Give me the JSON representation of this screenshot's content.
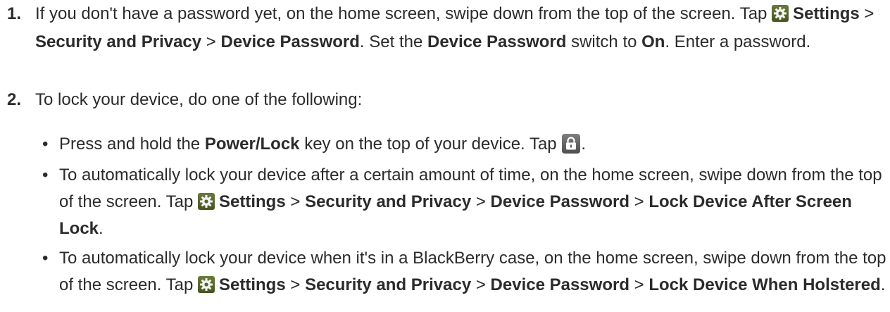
{
  "steps": [
    {
      "number": "1.",
      "segments": [
        {
          "t": "If you don't have a password yet, on the home screen, swipe down from the top of the screen. Tap "
        },
        {
          "icon": "settings-icon"
        },
        {
          "b": "Settings"
        },
        {
          "t": " > "
        },
        {
          "b": "Security and Privacy"
        },
        {
          "t": " > "
        },
        {
          "b": "Device Password"
        },
        {
          "t": ". Set the "
        },
        {
          "b": "Device Password"
        },
        {
          "t": " switch to "
        },
        {
          "b": "On"
        },
        {
          "t": ". Enter a password."
        }
      ]
    },
    {
      "number": "2.",
      "segments": [
        {
          "t": "To lock your device, do one of the following:"
        }
      ]
    }
  ],
  "bullets": [
    {
      "bullet": "•",
      "segments": [
        {
          "t": "Press and hold the "
        },
        {
          "b": "Power/Lock"
        },
        {
          "t": " key on the top of your device. Tap "
        },
        {
          "icon": "lock-icon"
        },
        {
          "t": "."
        }
      ]
    },
    {
      "bullet": "•",
      "segments": [
        {
          "t": "To automatically lock your device after a certain amount of time, on the home screen, swipe down from the top of the screen. Tap "
        },
        {
          "icon": "settings-icon"
        },
        {
          "b": "Settings"
        },
        {
          "t": " > "
        },
        {
          "b": "Security and Privacy"
        },
        {
          "t": " > "
        },
        {
          "b": "Device Password"
        },
        {
          "t": " > "
        },
        {
          "b": "Lock Device After Screen Lock"
        },
        {
          "t": "."
        }
      ]
    },
    {
      "bullet": "•",
      "segments": [
        {
          "t": "To automatically lock your device when it's in a BlackBerry case, on the home screen, swipe down from the top of the screen. Tap "
        },
        {
          "icon": "settings-icon"
        },
        {
          "b": "Settings"
        },
        {
          "t": " > "
        },
        {
          "b": "Security and Privacy"
        },
        {
          "t": " > "
        },
        {
          "b": "Device Password"
        },
        {
          "t": " > "
        },
        {
          "b": "Lock Device When Holstered"
        },
        {
          "t": "."
        }
      ]
    }
  ]
}
